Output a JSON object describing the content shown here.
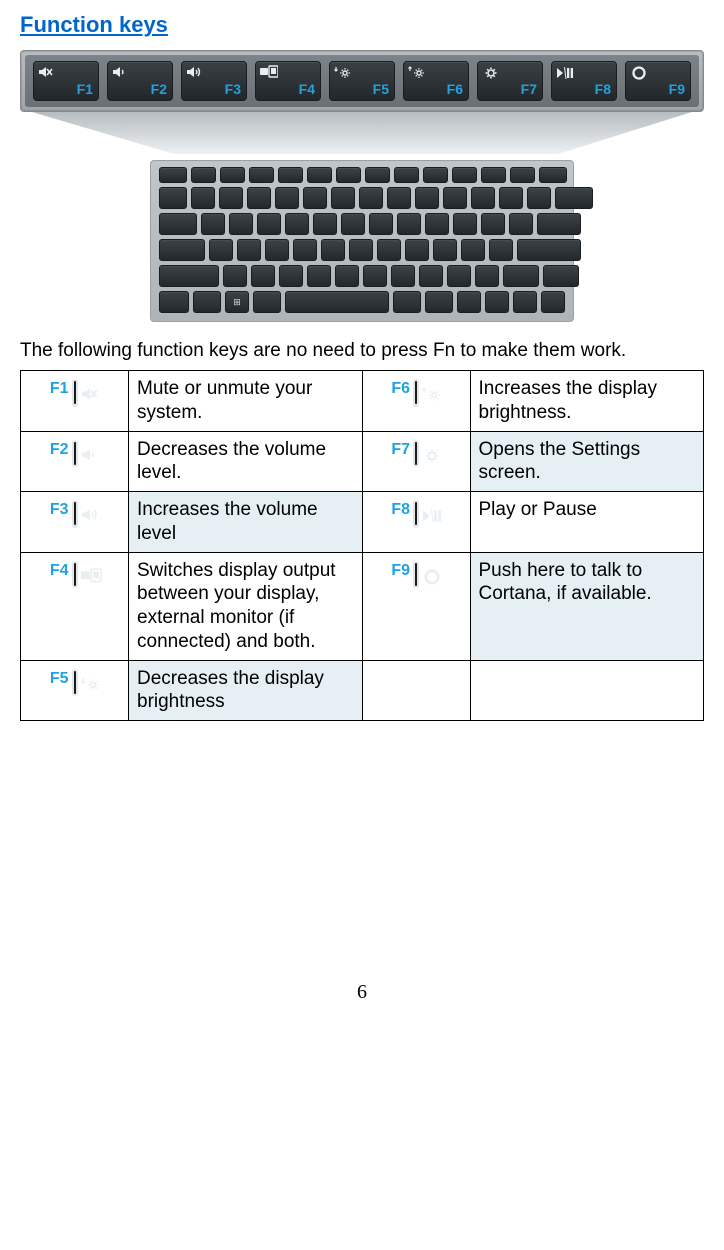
{
  "title": "Function keys",
  "intro": "The following function keys are no need to press Fn to make them work.",
  "page_number": "6",
  "keys": [
    {
      "id": "F1",
      "icon": "mute-icon",
      "desc": "Mute or unmute your system.",
      "shade": false
    },
    {
      "id": "F2",
      "icon": "volume-down-icon",
      "desc": "Decreases the volume level.",
      "shade": false
    },
    {
      "id": "F3",
      "icon": "volume-up-icon",
      "desc": "Increases the volume level",
      "shade": true
    },
    {
      "id": "F4",
      "icon": "display-switch-icon",
      "desc": "Switches display output between your display, external monitor (if connected) and both.",
      "shade": false
    },
    {
      "id": "F5",
      "icon": "brightness-down-icon",
      "desc": "Decreases the display brightness",
      "shade": true
    },
    {
      "id": "F6",
      "icon": "brightness-up-icon",
      "desc": "Increases the display brightness.",
      "shade": false
    },
    {
      "id": "F7",
      "icon": "settings-gear-icon",
      "desc": "Opens the Settings screen.",
      "shade": true
    },
    {
      "id": "F8",
      "icon": "play-pause-icon",
      "desc": "Play or Pause",
      "shade": false
    },
    {
      "id": "F9",
      "icon": "cortana-ring-icon",
      "desc": "Push here to talk to Cortana, if available.",
      "shade": true
    }
  ]
}
